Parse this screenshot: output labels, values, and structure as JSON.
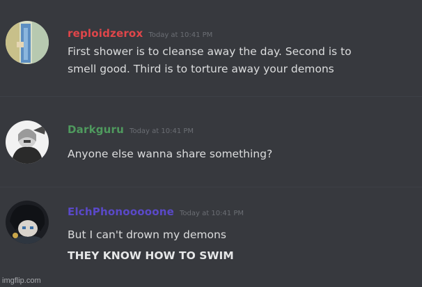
{
  "colors": {
    "background": "#37393e",
    "message_text": "#dcddde",
    "timestamp": "#6b6e74"
  },
  "messages": [
    {
      "username": "reploidzerox",
      "username_color": "#e0464a",
      "timestamp": "Today at 10:41 PM",
      "avatar_icon": "anime-character-avatar",
      "lines": [
        "First shower is to cleanse away the day. Second is to",
        "smell good. Third is to torture away your demons"
      ]
    },
    {
      "username": "Darkguru",
      "username_color": "#4f9a5e",
      "timestamp": "Today at 10:41 PM",
      "avatar_icon": "grayscale-portrait-avatar",
      "lines": [
        "Anyone else wanna share something?"
      ]
    },
    {
      "username": "ElchPhonooooone",
      "username_color": "#5a49c8",
      "timestamp": "Today at 10:41 PM",
      "avatar_icon": "anime-dark-hair-avatar",
      "lines": [
        "But I can't drown my demons",
        "THEY KNOW HOW TO SWIM"
      ]
    }
  ],
  "watermark": "imgflip.com"
}
